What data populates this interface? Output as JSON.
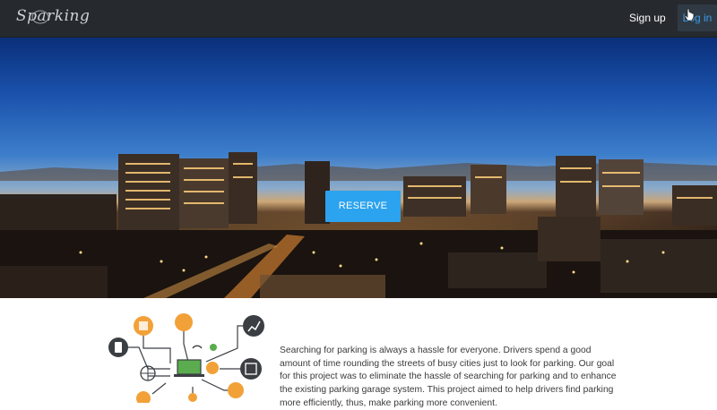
{
  "brand": {
    "name": "Sparking"
  },
  "nav": {
    "signup_label": "Sign up",
    "login_label": "Log in"
  },
  "hero": {
    "reserve_label": "RESERVE"
  },
  "about": {
    "text": "Searching for parking is always a hassle for everyone. Drivers spend a good amount of time rounding the streets of busy cities just to look for parking. Our goal for this project was to eliminate the hassle of searching for parking and to enhance the existing parking garage system. This project aimed to help drivers find parking more efficiently, thus, make parking more convenient."
  },
  "colors": {
    "navbar": "#262a2f",
    "login_text": "#3d9be9",
    "reserve_button": "#2ba3ee",
    "illustration_orange": "#f2a138",
    "illustration_dark": "#3b3f44"
  }
}
